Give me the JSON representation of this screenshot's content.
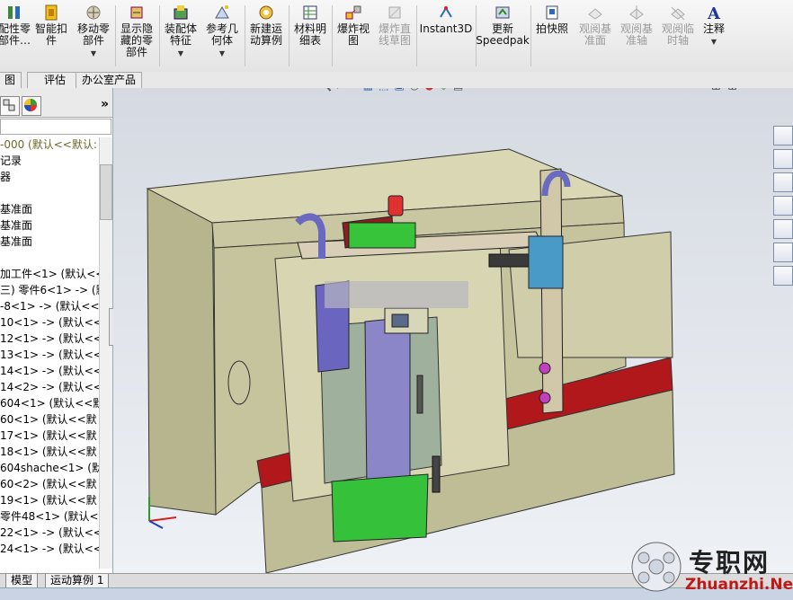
{
  "ribbon": {
    "buttons": [
      {
        "label": "配性零\n部件…",
        "icon": "mate-icon"
      },
      {
        "label": "智能扣\n件",
        "icon": "smart-fastener-icon"
      },
      {
        "label": "移动零\n部件",
        "icon": "move-component-icon"
      },
      {
        "label": "显示隐\n藏的零\n部件",
        "icon": "show-hidden-icon"
      },
      {
        "label": "装配体\n特征",
        "icon": "assembly-feature-icon"
      },
      {
        "label": "参考几\n何体",
        "icon": "reference-geometry-icon"
      },
      {
        "label": "新建运\n动算例",
        "icon": "motion-study-icon"
      },
      {
        "label": "材料明\n细表",
        "icon": "bom-icon"
      },
      {
        "label": "爆炸视\n图",
        "icon": "exploded-view-icon"
      },
      {
        "label": "爆炸直\n线草图",
        "icon": "explode-line-icon"
      },
      {
        "label": "Instant3D",
        "icon": "instant3d-icon"
      },
      {
        "label": "更新\nSpeedpak",
        "icon": "speedpak-icon"
      },
      {
        "label": "拍快照",
        "icon": "snapshot-icon"
      },
      {
        "label": "观阅基\n准面",
        "icon": "view-planes-icon"
      },
      {
        "label": "观阅基\n准轴",
        "icon": "view-axes-icon"
      },
      {
        "label": "观阅临\n时轴",
        "icon": "view-temp-axes-icon"
      },
      {
        "label": "注释",
        "icon": "annotation-icon"
      }
    ]
  },
  "command_tabs": [
    "图",
    "评估",
    "办公室产品"
  ],
  "tree": {
    "root": "-000 (默认<<默认:",
    "items": [
      "记录",
      "器",
      "",
      "基准面",
      "基准面",
      "基准面",
      "",
      "加工件<1> (默认<<",
      "三) 零件6<1> -> (默",
      "-8<1> -> (默认<<",
      "10<1> -> (默认<<",
      "12<1> -> (默认<<",
      "13<1> -> (默认<<",
      "14<1> -> (默认<<",
      "14<2> -> (默认<<",
      "604<1> (默认<<默",
      "60<1> (默认<<默",
      "17<1> (默认<<默",
      "18<1> (默认<<默",
      "604shache<1> (默",
      "60<2> (默认<<默",
      "19<1> (默认<<默",
      "零件48<1> (默认<",
      "22<1> -> (默认<<",
      "24<1> -> (默认<<"
    ]
  },
  "bottom_tabs": [
    "模型",
    "运动算例 1"
  ],
  "watermark": {
    "brand": "专职网",
    "url": "Zhuanzhi.Net"
  },
  "colors": {
    "accent": "#d01818",
    "body": "#c9c7a0",
    "red_band": "#b0181c",
    "purple": "#8a86c8",
    "green": "#35c23a"
  }
}
